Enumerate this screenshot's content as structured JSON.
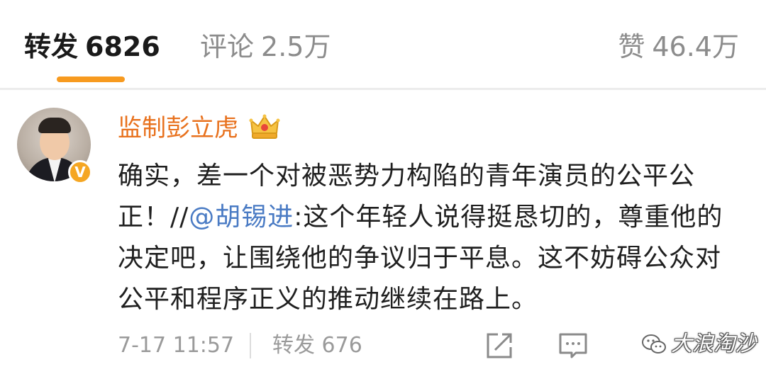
{
  "tabs": {
    "repost": {
      "label": "转发",
      "count": "6826"
    },
    "comment": {
      "label": "评论",
      "count": "2.5万"
    },
    "like": {
      "label": "赞",
      "count": "46.4万"
    }
  },
  "post": {
    "username": "监制彭立虎",
    "verified_badge": "V",
    "text_part1": "确实，差一个对被恶势力构陷的青年演员的公平公正！//",
    "mention": "@胡锡进",
    "text_part2": ":这个年轻人说得挺恳切的，尊重他的决定吧，让围绕他的争议归于平息。这不妨碍公众对公平和程序正义的推动继续在路上。",
    "time": "7-17 11:57",
    "repost_label": "转发 676"
  },
  "icons": [
    "crown-icon",
    "share-icon",
    "comment-icon",
    "like-icon",
    "wechat-icon"
  ],
  "watermark": {
    "text": "大浪淘沙"
  },
  "colors": {
    "accent": "#f79a1f",
    "username": "#e8711d",
    "mention": "#4a7bc4"
  }
}
